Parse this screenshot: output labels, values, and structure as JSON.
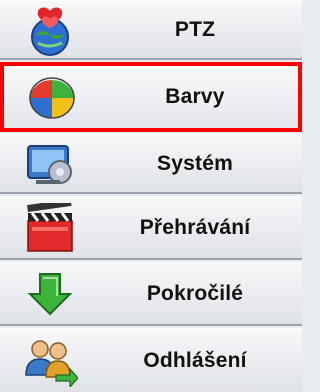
{
  "menu": {
    "items": [
      {
        "label": "PTZ",
        "icon": "ptz-hearts-globe-icon"
      },
      {
        "label": "Barvy",
        "icon": "color-palette-icon",
        "selected": true
      },
      {
        "label": "Systém",
        "icon": "system-settings-icon"
      },
      {
        "label": "Přehrávání",
        "icon": "playback-clapperboard-icon"
      },
      {
        "label": "Pokročilé",
        "icon": "advanced-download-arrow-icon"
      },
      {
        "label": "Odhlášení",
        "icon": "logout-users-icon"
      }
    ],
    "selected_border_color": "#ff0000"
  }
}
